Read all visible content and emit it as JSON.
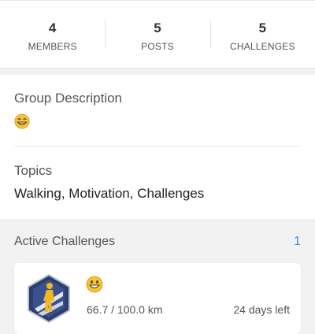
{
  "stats": [
    {
      "value": "4",
      "label": "MEMBERS"
    },
    {
      "value": "5",
      "label": "POSTS"
    },
    {
      "value": "5",
      "label": "CHALLENGES"
    }
  ],
  "group": {
    "description_title": "Group Description",
    "description_emoji": "grinning-face-with-smiling-eyes-icon",
    "topics_title": "Topics",
    "topics_value": "Walking, Motivation, Challenges"
  },
  "active_challenges": {
    "title": "Active Challenges",
    "count": "1",
    "items": [
      {
        "emoji": "grinning-face-icon",
        "badge_icon": "walker-badge-icon",
        "progress": "66.7 / 100.0 km",
        "progress_fraction": 0.667,
        "days_left": "24 days left"
      }
    ]
  },
  "colors": {
    "accent": "#2f8fdc",
    "badge_dark": "#2c3e6b",
    "badge_figure": "#f2b820",
    "page_bg": "#f2f2f2"
  }
}
